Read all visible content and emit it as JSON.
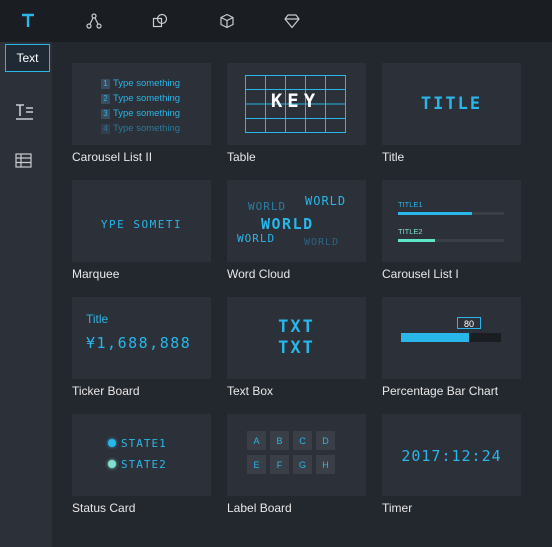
{
  "toolbar": {
    "tabs": [
      {
        "icon": "text-icon",
        "active": true
      },
      {
        "icon": "graph-nodes-icon"
      },
      {
        "icon": "overlap-shapes-icon"
      },
      {
        "icon": "cube-icon"
      },
      {
        "icon": "gem-icon"
      }
    ]
  },
  "sidebar": {
    "text_button": "Text",
    "items": [
      {
        "icon": "text-lines-icon"
      },
      {
        "icon": "table-icon"
      }
    ]
  },
  "components": [
    {
      "label": "Carousel List II",
      "preview": {
        "rows": [
          {
            "num": "1",
            "text": "Type something"
          },
          {
            "num": "2",
            "text": "Type something"
          },
          {
            "num": "3",
            "text": "Type something"
          },
          {
            "num": "4",
            "text": "Type something"
          }
        ]
      }
    },
    {
      "label": "Table",
      "preview": {
        "text": "KEY"
      }
    },
    {
      "label": "Title",
      "preview": {
        "text": "TITLE"
      }
    },
    {
      "label": "Marquee",
      "preview": {
        "text": "YPE SOMETI"
      }
    },
    {
      "label": "Word Cloud",
      "preview": {
        "words": [
          "WORLD",
          "WORLD",
          "WORLD",
          "WORLD",
          "WORLD"
        ]
      }
    },
    {
      "label": "Carousel List I",
      "preview": {
        "items": [
          {
            "name": "TITLE1",
            "level": 0.7
          },
          {
            "name": "TITLE2",
            "level": 0.35
          }
        ]
      }
    },
    {
      "label": "Ticker Board",
      "preview": {
        "title": "Title",
        "value": "¥1,688,888"
      }
    },
    {
      "label": "Text Box",
      "preview": {
        "line1": "TXT",
        "line2": "TXT"
      }
    },
    {
      "label": "Percentage Bar Chart",
      "preview": {
        "value": "80",
        "level": 0.68
      }
    },
    {
      "label": "Status Card",
      "preview": {
        "states": [
          "STATE1",
          "STATE2"
        ]
      }
    },
    {
      "label": "Label Board",
      "preview": {
        "letters": [
          "A",
          "B",
          "C",
          "D",
          "E",
          "F",
          "G",
          "H"
        ]
      }
    },
    {
      "label": "Timer",
      "preview": {
        "time": "2017:12:24"
      }
    }
  ],
  "colors": {
    "accent": "#29b6e9",
    "bg": "#23272e",
    "card": "#2c3038",
    "topbar": "#1a1d22"
  }
}
